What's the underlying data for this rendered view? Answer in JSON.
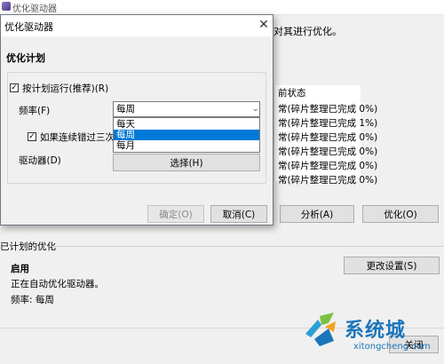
{
  "background_window": {
    "title": "优化驱动器",
    "description": "对其进行优化。",
    "column_header": "前状态",
    "drive_statuses": [
      "常(碎片整理已完成 0%)",
      "常(碎片整理已完成 1%)",
      "常(碎片整理已完成 0%)",
      "常(碎片整理已完成 0%)",
      "常(碎片整理已完成 0%)",
      "常(碎片整理已完成 0%)"
    ],
    "analyze_label": "分析(A)",
    "optimize_label": "优化(O)",
    "scheduled_label": "已计划的优化",
    "status_title": "启用",
    "status_desc": "正在自动优化驱动器。",
    "frequency_text": "频率: 每周",
    "change_settings_label": "更改设置(S)",
    "close_label": "关闭"
  },
  "dialog": {
    "title": "优化驱动器",
    "close_glyph": "✕",
    "heading": "优化计划",
    "schedule_checkbox_label": "按计划运行(推荐)(R)",
    "schedule_checked": true,
    "frequency_label": "频率(F)",
    "frequency_selected": "每周",
    "frequency_options": [
      "每天",
      "每周",
      "每月"
    ],
    "notify_checkbox_label": "如果连续错过三次计划",
    "notify_checked": true,
    "drives_label": "驱动器(D)",
    "choose_label": "选择(H)",
    "ok_label": "确定(O)",
    "cancel_label": "取消(C)"
  },
  "watermark": {
    "brand": "系统城",
    "url": "xitongcheng.com"
  },
  "colors": {
    "selection": "#0078d7",
    "brand_blue": "#1b75bb"
  }
}
